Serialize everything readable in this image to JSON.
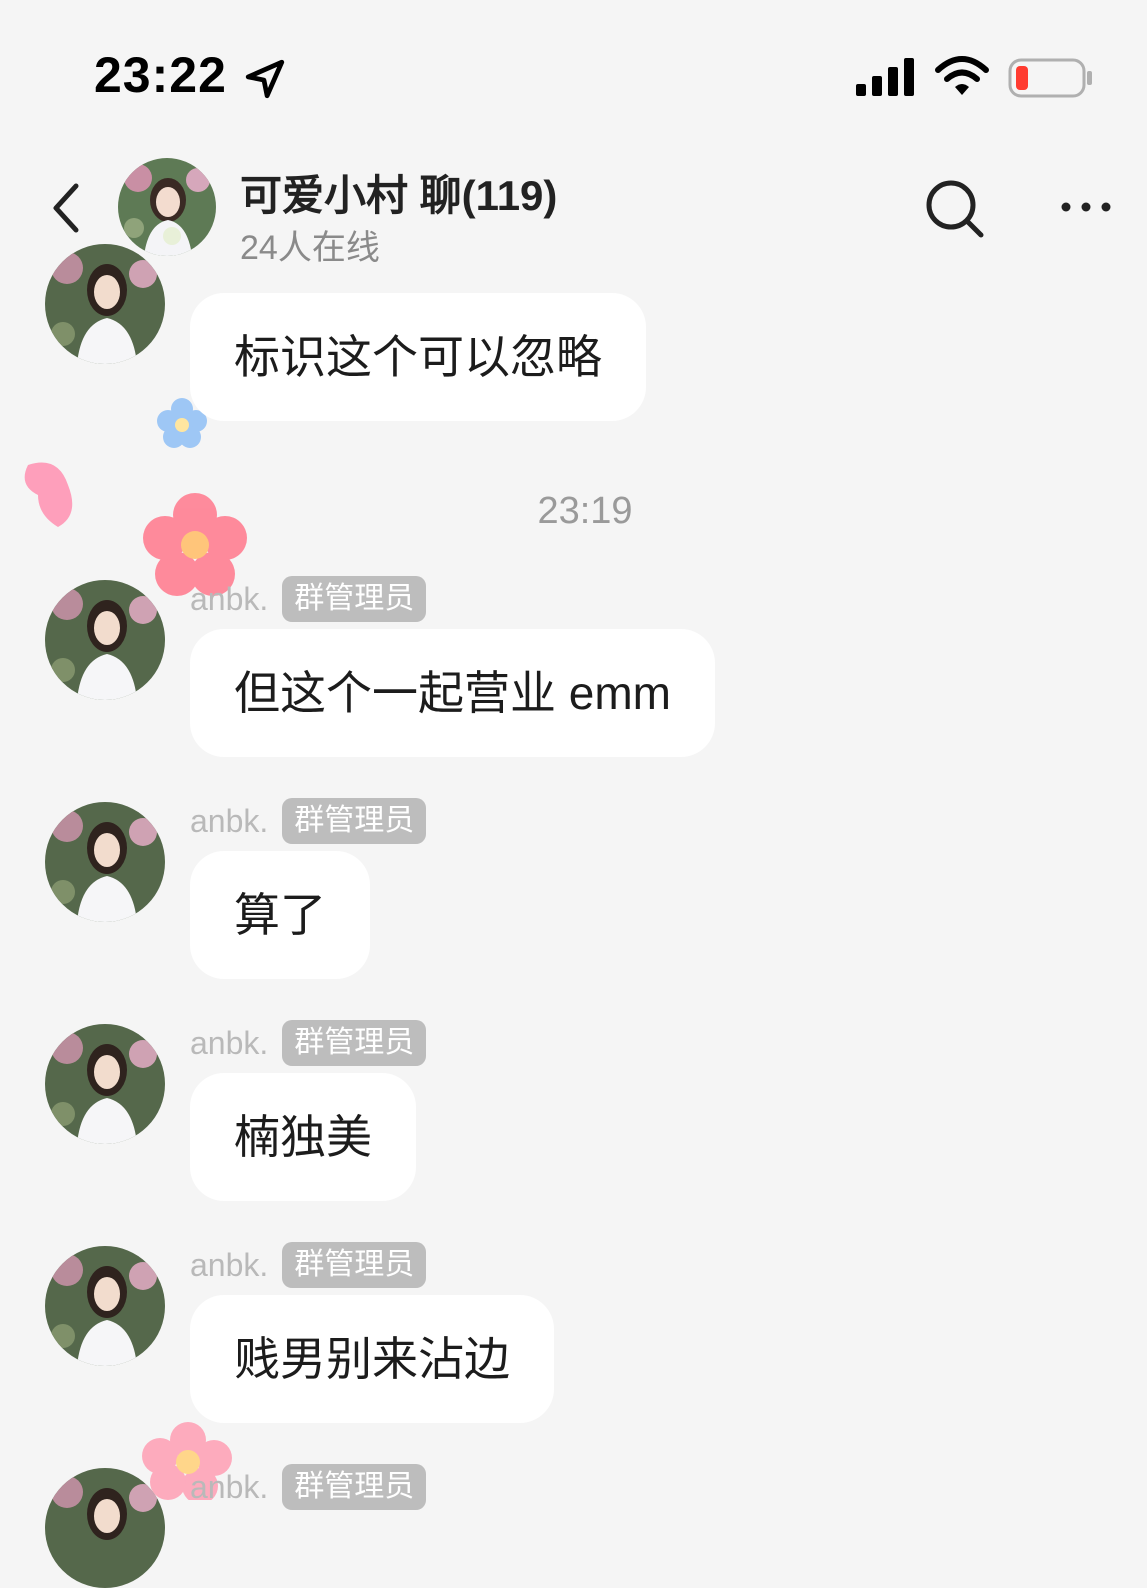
{
  "status_bar": {
    "time": "23:22",
    "icons": [
      "location-arrow-icon",
      "cellular-signal-icon",
      "wifi-icon",
      "battery-low-icon"
    ],
    "battery_color": "#ff3b30"
  },
  "header": {
    "title": "可爱小村    聊(119)",
    "subtitle": "24人在线",
    "icons": [
      "back-chevron-icon",
      "search-icon",
      "more-dots-icon"
    ]
  },
  "messages": [
    {
      "sender": "",
      "badge": "",
      "text": "标识这个可以忽略"
    },
    {
      "sender": "anbk.",
      "badge": "群管理员",
      "text": "但这个一起营业 emm"
    },
    {
      "sender": "anbk.",
      "badge": "群管理员",
      "text": "算了"
    },
    {
      "sender": "anbk.",
      "badge": "群管理员",
      "text": "楠独美"
    },
    {
      "sender": "anbk.",
      "badge": "群管理员",
      "text": "贱男别来沾边"
    },
    {
      "sender": "anbk.",
      "badge": "群管理员",
      "text": ""
    }
  ],
  "timestamp": "23:19",
  "colors": {
    "background": "#f5f5f5",
    "bubble": "#ffffff",
    "badge": "#bdbdbd",
    "muted_text": "#9a9a9a"
  }
}
